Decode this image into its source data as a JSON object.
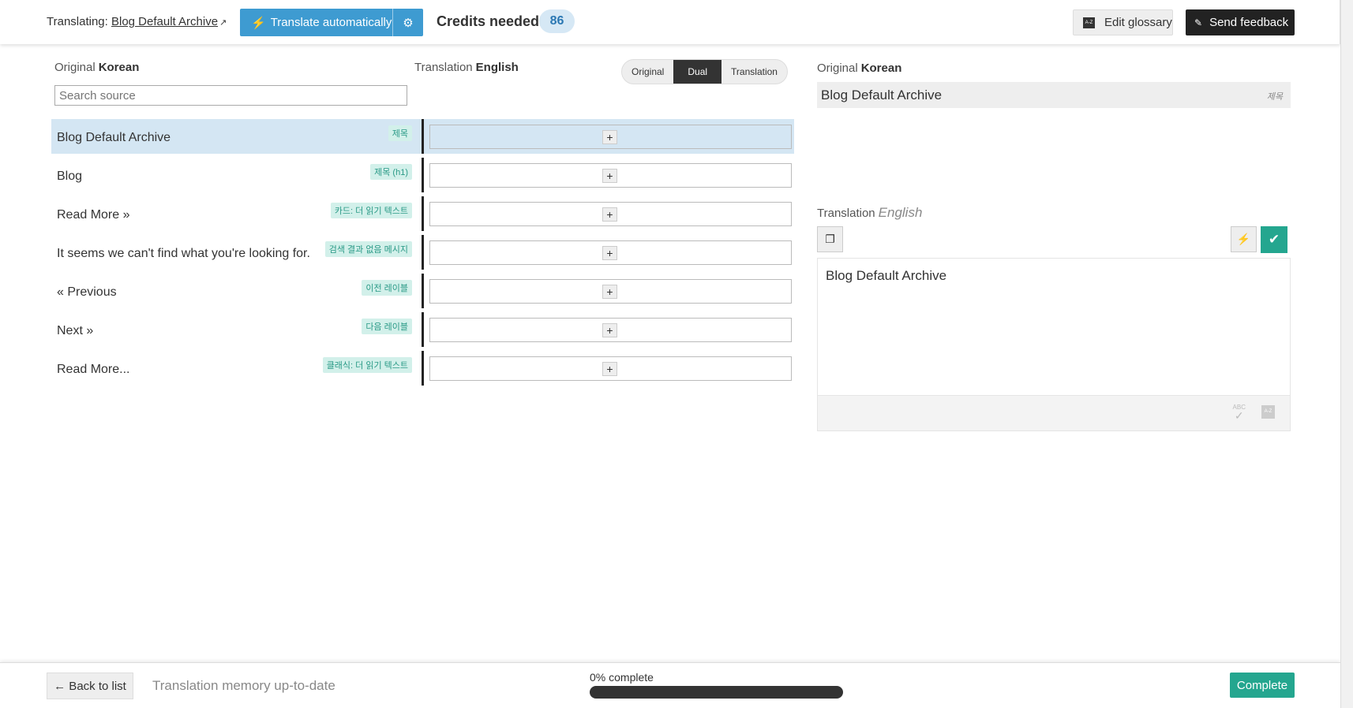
{
  "header": {
    "translating_label": "Translating:",
    "page_link": "Blog Default Archive",
    "translate_auto_label": "Translate automatically",
    "credits_label": "Credits needed",
    "credits_value": "86",
    "edit_glossary_label": "Edit glossary",
    "send_feedback_label": "Send feedback"
  },
  "left": {
    "original_label": "Original",
    "original_lang": "Korean",
    "translation_label": "Translation",
    "translation_lang": "English",
    "search_placeholder": "Search source",
    "view_modes": [
      "Original",
      "Dual",
      "Translation"
    ],
    "active_view": "Dual",
    "rows": [
      {
        "source": "Blog Default Archive",
        "tag": "제목",
        "selected": true
      },
      {
        "source": "Blog",
        "tag": "제목 (h1)",
        "selected": false
      },
      {
        "source": "Read More »",
        "tag": "카드: 더 읽기 텍스트",
        "selected": false
      },
      {
        "source": "It seems we can't find what you're looking for.",
        "tag": "검색 결과 없음 메시지",
        "selected": false
      },
      {
        "source": "« Previous",
        "tag": "이전 레이블",
        "selected": false
      },
      {
        "source": "Next »",
        "tag": "다음 레이블",
        "selected": false
      },
      {
        "source": "Read More...",
        "tag": "클래식: 더 읽기 텍스트",
        "selected": false
      }
    ],
    "add_symbol": "+"
  },
  "right": {
    "original_label": "Original",
    "original_lang": "Korean",
    "original_text": "Blog Default Archive",
    "original_tag": "제목",
    "translation_label": "Translation",
    "translation_lang": "English",
    "translation_text": "Blog Default Archive",
    "spellcheck_label": "ABC"
  },
  "footer": {
    "back_label": "← Back to list",
    "memory_status": "Translation memory up-to-date",
    "progress_label": "0% complete",
    "progress_fraction": 0,
    "complete_label": "Complete"
  },
  "colors": {
    "primary_blue": "#3e9bd1",
    "accent_green": "#24a68f",
    "selected_row": "#d4e6f3"
  }
}
